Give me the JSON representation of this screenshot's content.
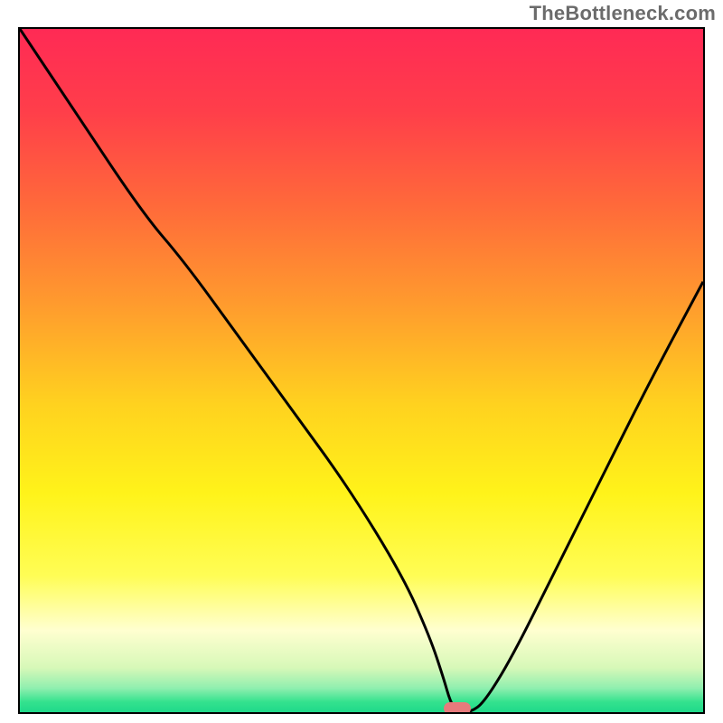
{
  "watermark": "TheBottleneck.com",
  "colors": {
    "frame": "#000000",
    "curve": "#000000",
    "marker": "#e77a7c",
    "gradient_stops": [
      {
        "offset": 0.0,
        "color": "#ff2a55"
      },
      {
        "offset": 0.12,
        "color": "#ff3e4a"
      },
      {
        "offset": 0.26,
        "color": "#ff6a3a"
      },
      {
        "offset": 0.4,
        "color": "#ff9a2e"
      },
      {
        "offset": 0.55,
        "color": "#ffd21f"
      },
      {
        "offset": 0.68,
        "color": "#fff31a"
      },
      {
        "offset": 0.8,
        "color": "#fffd55"
      },
      {
        "offset": 0.88,
        "color": "#ffffd0"
      },
      {
        "offset": 0.935,
        "color": "#d7f8b8"
      },
      {
        "offset": 0.965,
        "color": "#8fefaf"
      },
      {
        "offset": 0.985,
        "color": "#34e28e"
      },
      {
        "offset": 1.0,
        "color": "#1fd98a"
      }
    ]
  },
  "chart_data": {
    "type": "line",
    "title": "",
    "xlabel": "",
    "ylabel": "",
    "xlim": [
      0,
      100
    ],
    "ylim": [
      0,
      100
    ],
    "marker": {
      "x": 64,
      "y": 0,
      "radius_norm": 0.016
    },
    "series": [
      {
        "name": "curve",
        "x": [
          0,
          8,
          18,
          24,
          32,
          40,
          48,
          56,
          60,
          62,
          63,
          64,
          66,
          68,
          72,
          78,
          85,
          92,
          100
        ],
        "y": [
          100,
          88,
          73,
          66,
          55,
          44,
          33,
          20,
          11,
          5,
          1.5,
          0,
          0,
          1.5,
          8,
          20,
          34,
          48,
          63
        ]
      }
    ],
    "notes": "x and y are normalized 0–100; y=100 is top of the framed plot area, y=0 is bottom. The curve descends from top-left, reaches a flat minimum near x≈63–67, then rises toward the right edge. Values are visually estimated; the image has no visible ticks or axis text."
  }
}
